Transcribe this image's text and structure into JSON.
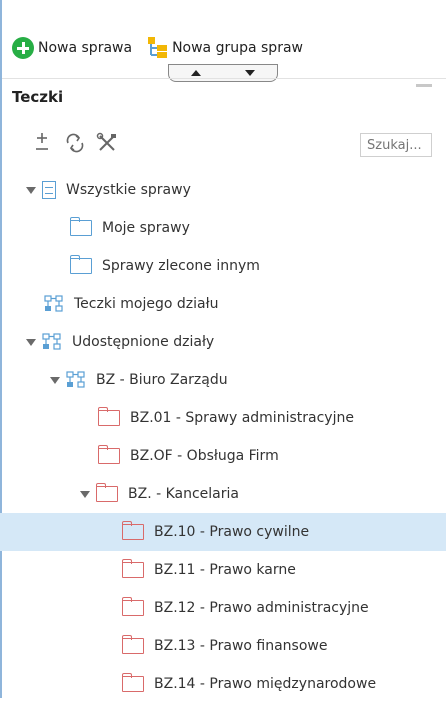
{
  "toolbar": {
    "new_case": "Nowa sprawa",
    "new_case_group": "Nowa grupa spraw"
  },
  "panel": {
    "title": "Teczki",
    "search_placeholder": "Szukaj..."
  },
  "tree": [
    {
      "label": "Wszystkie sprawy",
      "icon": "cabinet-icon",
      "expanded": true
    },
    {
      "label": "Moje sprawy",
      "icon": "folder-icon"
    },
    {
      "label": "Sprawy zlecone innym",
      "icon": "folder-icon"
    },
    {
      "label": "Teczki mojego działu",
      "icon": "org-icon"
    },
    {
      "label": "Udostępnione działy",
      "icon": "org-icon",
      "expanded": true
    },
    {
      "label": "BZ - Biuro Zarządu",
      "icon": "org-icon",
      "expanded": true
    },
    {
      "label": "BZ.01 - Sprawy administracyjne",
      "icon": "folder-icon"
    },
    {
      "label": "BZ.OF - Obsługa Firm",
      "icon": "folder-icon"
    },
    {
      "label": "BZ. - Kancelaria",
      "icon": "folder-icon",
      "expanded": true
    },
    {
      "label": "BZ.10 - Prawo cywilne",
      "icon": "folder-icon",
      "selected": true
    },
    {
      "label": "BZ.11 - Prawo karne",
      "icon": "folder-icon"
    },
    {
      "label": "BZ.12 - Prawo administracyjne",
      "icon": "folder-icon"
    },
    {
      "label": "BZ.13 - Prawo finansowe",
      "icon": "folder-icon"
    },
    {
      "label": "BZ.14 - Prawo międzynarodowe",
      "icon": "folder-icon"
    }
  ],
  "colors": {
    "accent_green": "#27ae45",
    "folder_blue": "#5a9fd4",
    "folder_red": "#d96a6a",
    "selected_row": "#d5e8f7"
  }
}
